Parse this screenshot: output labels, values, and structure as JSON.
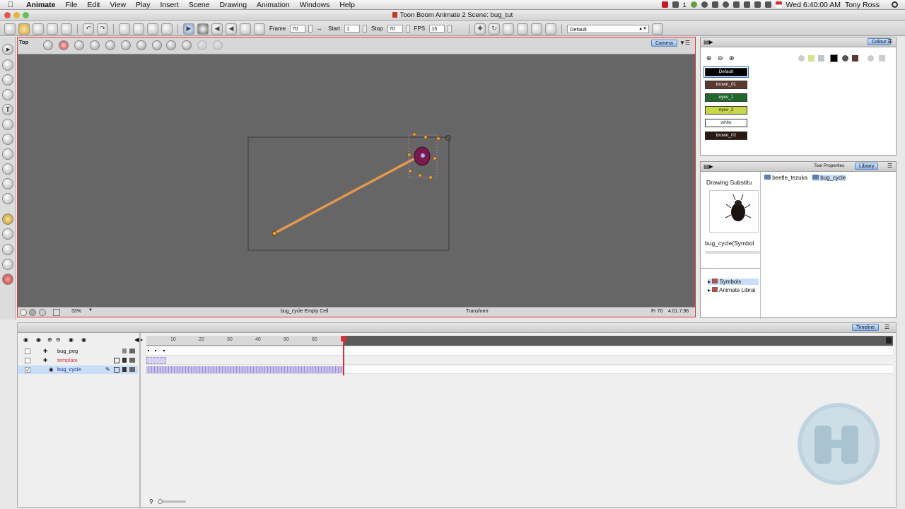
{
  "menubar": {
    "app_name": "Animate",
    "items": [
      "File",
      "Edit",
      "View",
      "Play",
      "Insert",
      "Scene",
      "Drawing",
      "Animation",
      "Windows",
      "Help"
    ],
    "clock": "Wed 6:40:00 AM",
    "user": "Tony Ross",
    "tray_text": "1"
  },
  "window": {
    "title": "Toon Boom Animate 2 Scene: bug_tut"
  },
  "toolbar": {
    "frame_label": "Frame",
    "frame_value": "70",
    "start_label": "Start",
    "start_value": "1",
    "stop_label": "Stop",
    "stop_value": "70",
    "fps_label": "FPS",
    "fps_value": "15",
    "workspace_select": "Default"
  },
  "camera_view": {
    "tab_label": "Top",
    "camera_chip": "Camera",
    "zoom": "33%",
    "status_center": "bug_cycle Empty Cell",
    "status_mode": "Transform",
    "status_frame": "Fr 70",
    "status_coords": "4.01.7.96"
  },
  "colour_panel": {
    "tab_label": "Colour",
    "swatches": [
      {
        "name": "Default",
        "color": "#000000",
        "text_color": "#ffffff"
      },
      {
        "name": "brown_01",
        "color": "#5a3a2c",
        "text_color": "#ffffff"
      },
      {
        "name": "eyes_1",
        "color": "#1e6a2a",
        "text_color": "#ffffff"
      },
      {
        "name": "eyes_2",
        "color": "#c9d84a",
        "text_color": "#1a1a1a"
      },
      {
        "name": "white",
        "color": "#ffffff",
        "text_color": "#222222"
      },
      {
        "name": "brown_02",
        "color": "#2a1812",
        "text_color": "#ffffff"
      }
    ]
  },
  "library_panel": {
    "tab_tool_properties": "Tool Properties",
    "tab_library": "Library",
    "drawing_sub_title": "Drawing Substitu",
    "symbol_name": "bug_cycle(Symbol",
    "tree_items": [
      "Symbols",
      "Animate Librai"
    ],
    "items": [
      "beetle_tezuka",
      "bug_cycle"
    ]
  },
  "timeline": {
    "tab_label": "Timeline",
    "layers": [
      {
        "name": "bug_peg",
        "color": "#222222",
        "checked": false
      },
      {
        "name": "template",
        "color": "#d43c3c",
        "checked": false
      },
      {
        "name": "bug_cycle",
        "color": "#223399",
        "checked": true
      }
    ],
    "ruler": [
      "10",
      "20",
      "30",
      "40",
      "50",
      "60"
    ],
    "current_frame": "70"
  },
  "colors": {
    "accent_red": "#d33333",
    "selection_blue": "#8fb6ea",
    "camera_bg": "#666666",
    "motion_path": "#d88a3c"
  }
}
